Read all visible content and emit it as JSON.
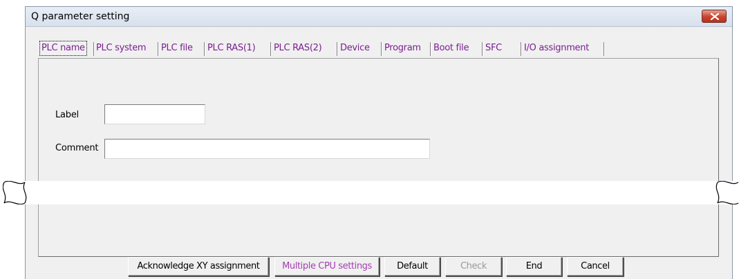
{
  "window": {
    "title": "Q parameter setting",
    "close_icon": "close-icon"
  },
  "tabs": [
    {
      "label": "PLC name",
      "active": true
    },
    {
      "label": "PLC system"
    },
    {
      "label": "PLC file"
    },
    {
      "label": "PLC RAS(1)"
    },
    {
      "label": "PLC RAS(2)"
    },
    {
      "label": "Device"
    },
    {
      "label": "Program"
    },
    {
      "label": "Boot file"
    },
    {
      "label": "SFC"
    },
    {
      "label": "I/O assignment"
    }
  ],
  "form": {
    "label_caption": "Label",
    "label_value": "",
    "comment_caption": "Comment",
    "comment_value": ""
  },
  "buttons": {
    "acknowledge": "Acknowledge XY assignment",
    "multiple_cpu": "Multiple CPU settings",
    "default": "Default",
    "check": "Check",
    "end": "End",
    "cancel": "Cancel"
  },
  "colors": {
    "tab_text": "#7a1f8f",
    "close_button": "#c8442f",
    "multiple_cpu_text": "#a33fb0",
    "disabled_text": "#9a9a9a"
  }
}
